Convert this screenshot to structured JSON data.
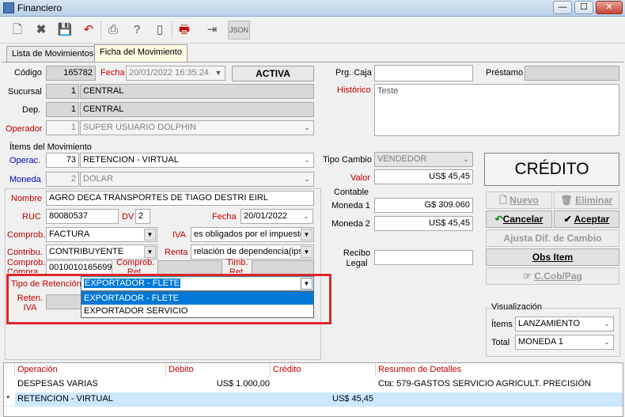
{
  "window": {
    "title": "Financiero",
    "min": "—",
    "max": "☐",
    "close": "✕"
  },
  "toolbar": {
    "icons": [
      "new-icon",
      "delete-icon",
      "save-icon",
      "undo-icon",
      "print-icon",
      "help-icon",
      "door-icon",
      "printer-red-icon",
      "export-icon",
      "json-icon"
    ],
    "json_label": "JSON"
  },
  "tabs": [
    "Lista de Movimientos",
    "Ficha del Movimiento"
  ],
  "header": {
    "codigo_label": "Código",
    "codigo": "165782",
    "fecha_label": "Fecha",
    "fecha": "20/01/2022 16:35:24",
    "status": "ACTIVA",
    "sucursal_label": "Sucursal",
    "sucursal_num": "1",
    "sucursal": "CENTRAL",
    "dep_label": "Dep.",
    "dep_num": "1",
    "dep": "CENTRAL",
    "operador_label": "Operador",
    "operador_num": "1",
    "operador": "SUPER USUARIO DOLPHIN",
    "prg_caja_label": "Prg. Caja",
    "prestamo_label": "Préstamo",
    "historico_label": "Histórico",
    "historico": "Teste"
  },
  "items": {
    "section": "Ítems del Movimiento",
    "operac_label": "Operac.",
    "operac_num": "73",
    "operac": "RETENCION - VIRTUAL",
    "moneda_label": "Moneda",
    "moneda_num": "2",
    "moneda": "DOLAR",
    "tipo_cambio_label": "Tipo Cambio",
    "tipo_cambio": "VENDEDOR",
    "valor_label": "Valor",
    "valor": "US$ 45,45",
    "contable_label": "Contable",
    "moneda1_label": "Moneda 1",
    "moneda1": "G$ 309.060",
    "moneda2_label": "Moneda 2",
    "moneda2": "US$ 45,45",
    "recibo_label": "Recibo Legal",
    "credito": "CRÉDITO"
  },
  "detail": {
    "nombre_label": "Nombre",
    "nombre": "AGRO DECA TRANSPORTES DE TIAGO DESTRI EIRL",
    "ruc_label": "RUC",
    "ruc": "80080537",
    "dv_label": "DV",
    "dv": "2",
    "fecha_label": "Fecha",
    "fecha": "20/01/2022",
    "comprob_label": "Comprob.",
    "comprob": "FACTURA",
    "iva_label": "IVA",
    "iva": "es obligados por el impuesto",
    "contrib_label": "Contribu.",
    "contrib": "CONTRIBUYENTE",
    "renta_label": "Renta",
    "renta": "relación de dependencia(ips)",
    "comprob_compra_label": "Comprob. Compra",
    "comprob_compra": "0010010165699",
    "comprob_ret_label": "Comprob. Ret.",
    "timb_ret_label": "Timb. Ret.",
    "tipo_ret_label": "Tipo de Retención",
    "tipo_ret": "EXPORTADOR - FLETE",
    "reten_iva_label": "Reten. IVA",
    "dropdown_options": [
      "EXPORTADOR - FLETE",
      "EXPORTADOR SERVICIO"
    ]
  },
  "actions": {
    "nuevo": "Nuevo",
    "eliminar": "Eliminar",
    "cancelar": "Cancelar",
    "aceptar": "Aceptar",
    "ajusta": "Ajusta Dif. de Cambio",
    "obs": "Obs Item",
    "ccob": "C.Cob/Pag"
  },
  "visualizacion": {
    "title": "Visualización",
    "items_label": "Ítems",
    "items": "LANZAMIENTO",
    "total_label": "Total",
    "total": "MONEDA 1"
  },
  "grid": {
    "headers": [
      "Operación",
      "Débito",
      "Crédito",
      "Resumen de Detalles"
    ],
    "rows": [
      {
        "marker": "",
        "op": "DESPESAS VARIAS",
        "debito": "US$ 1.000,00",
        "credito": "",
        "resumen": "Cta: 579-GASTOS SERVICIO AGRICULT. PRECISIÓN"
      },
      {
        "marker": "*",
        "op": "RETENCION - VIRTUAL",
        "debito": "",
        "credito": "US$ 45,45",
        "resumen": ""
      }
    ]
  }
}
